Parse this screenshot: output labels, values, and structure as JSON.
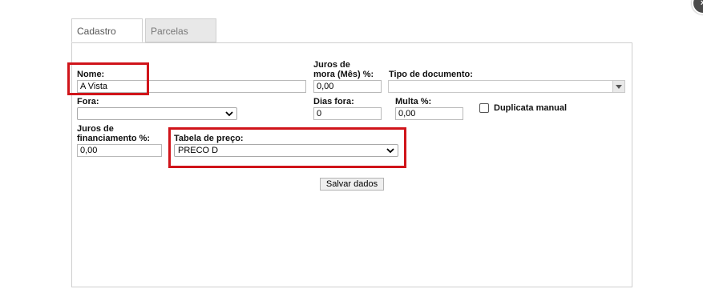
{
  "window": {
    "close_label": "×"
  },
  "tabs": [
    {
      "label": "Cadastro",
      "active": true
    },
    {
      "label": "Parcelas",
      "active": false
    }
  ],
  "form": {
    "nome": {
      "label": "Nome:",
      "value": "A Vista"
    },
    "juros_mora": {
      "label_line1": "Juros de",
      "label_line2": "mora (Mês) %:",
      "value": "0,00"
    },
    "tipo_documento": {
      "label": "Tipo de documento:",
      "value": ""
    },
    "fora": {
      "label": "Fora:",
      "value": ""
    },
    "dias_fora": {
      "label": "Dias fora:",
      "value": "0"
    },
    "multa": {
      "label": "Multa %:",
      "value": "0,00"
    },
    "duplicata_manual": {
      "label": "Duplicata manual",
      "checked": false
    },
    "juros_financiamento": {
      "label_line1": "Juros de",
      "label_line2": "financiamento %:",
      "value": "0,00"
    },
    "tabela_preco": {
      "label": "Tabela de preço:",
      "value": "PRECO D"
    },
    "save_label": "Salvar dados"
  },
  "colors": {
    "highlight": "#d0141a",
    "tab_inactive_bg": "#e8e8e8",
    "border": "#cfcfcf"
  }
}
